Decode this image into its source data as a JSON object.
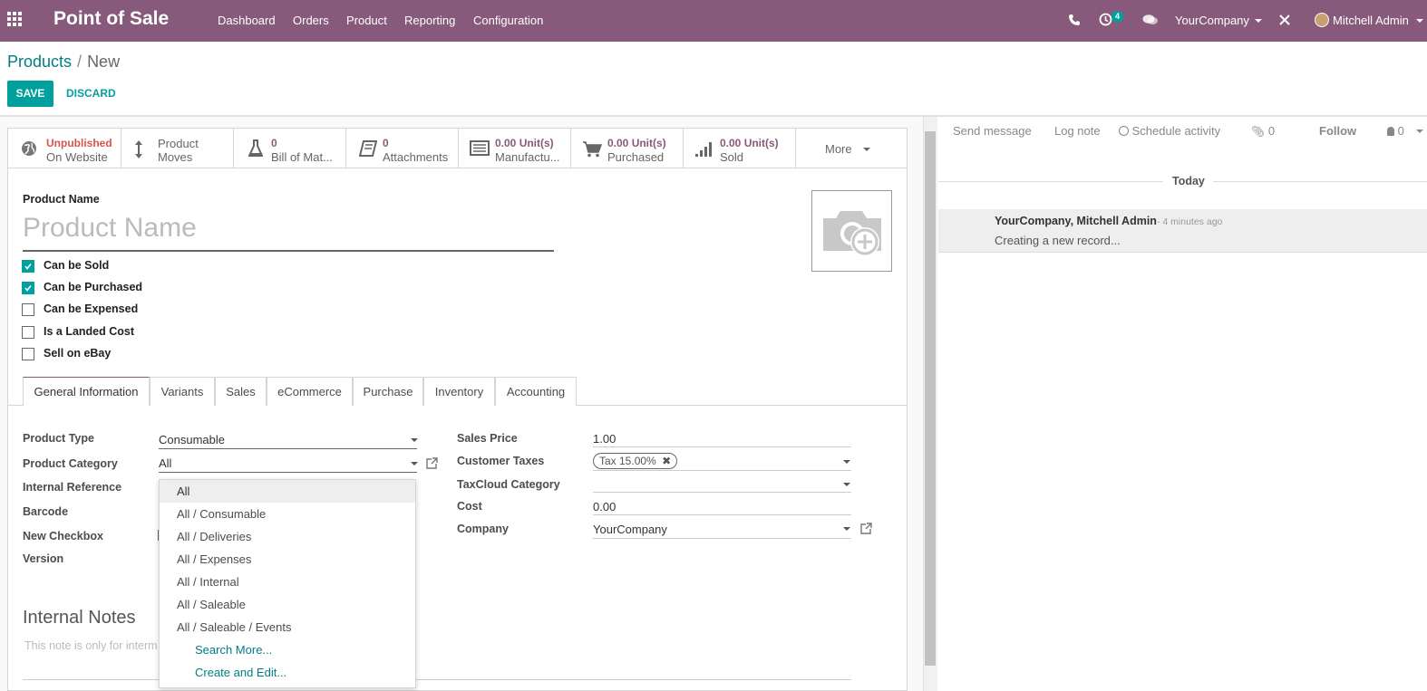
{
  "navbar": {
    "app_name": "Point of Sale",
    "menu": [
      "Dashboard",
      "Orders",
      "Product",
      "Reporting",
      "Configuration"
    ],
    "activity_count": "4",
    "company": "YourCompany",
    "user": "Mitchell Admin",
    "color": "#875a7b"
  },
  "breadcrumb": {
    "parent": "Products",
    "separator": "/",
    "current": "New"
  },
  "actions": {
    "save": "SAVE",
    "discard": "DISCARD"
  },
  "smart_buttons": {
    "website": {
      "value": "Unpublished",
      "label": "On Website"
    },
    "moves": {
      "line1": "Product",
      "line2": "Moves"
    },
    "bom": {
      "value": "0",
      "label": "Bill of Mat..."
    },
    "attachments": {
      "value": "0",
      "label": "Attachments"
    },
    "manufactured": {
      "value": "0.00 Unit(s)",
      "label": "Manufactu..."
    },
    "purchased": {
      "value": "0.00 Unit(s)",
      "label": "Purchased"
    },
    "sold": {
      "value": "0.00 Unit(s)",
      "label": "Sold"
    },
    "more": "More"
  },
  "product": {
    "name_label": "Product Name",
    "name_placeholder": "Product Name",
    "checkboxes": [
      {
        "label": "Can be Sold",
        "checked": true
      },
      {
        "label": "Can be Purchased",
        "checked": true
      },
      {
        "label": "Can be Expensed",
        "checked": false
      },
      {
        "label": "Is a Landed Cost",
        "checked": false
      },
      {
        "label": "Sell on eBay",
        "checked": false
      }
    ]
  },
  "tabs": [
    "General Information",
    "Variants",
    "Sales",
    "eCommerce",
    "Purchase",
    "Inventory",
    "Accounting"
  ],
  "general": {
    "left_labels": [
      "Product Type",
      "Product Category",
      "Internal Reference",
      "Barcode",
      "New Checkbox",
      "Version"
    ],
    "product_type": "Consumable",
    "product_category": "All",
    "right_labels": [
      "Sales Price",
      "Customer Taxes",
      "TaxCloud Category",
      "Cost",
      "Company"
    ],
    "sales_price": "1.00",
    "tax_tag": "Tax 15.00%",
    "cost": "0.00",
    "company": "YourCompany"
  },
  "notes": {
    "title": "Internal Notes",
    "placeholder": "This note is only for interm"
  },
  "category_dropdown": {
    "options": [
      "All",
      "All / Consumable",
      "All / Deliveries",
      "All / Expenses",
      "All / Internal",
      "All / Saleable",
      "All / Saleable / Events"
    ],
    "search_more": "Search More...",
    "create_edit": "Create and Edit..."
  },
  "chatter": {
    "send_message": "Send message",
    "log_note": "Log note",
    "schedule_activity": "Schedule activity",
    "attachments_count": "0",
    "follow": "Follow",
    "followers_count": "0",
    "today": "Today",
    "message": {
      "author": "YourCompany, Mitchell Admin",
      "time": "- 4 minutes ago",
      "body": "Creating a new record..."
    }
  }
}
